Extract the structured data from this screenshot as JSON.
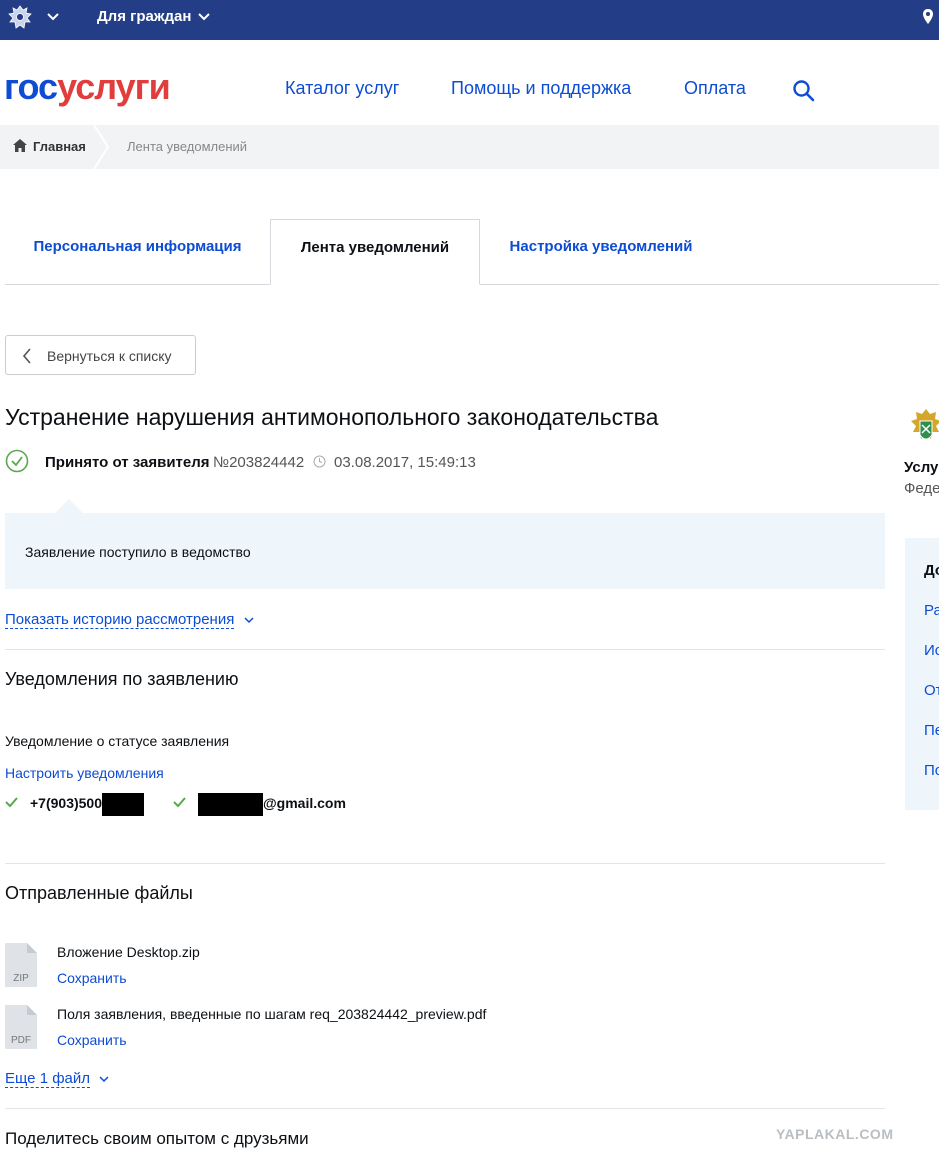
{
  "topbar": {
    "citizens_label": "Для граждан",
    "icons": [
      "emblem-icon",
      "chevron-down-icon",
      "location-pin-icon"
    ]
  },
  "header": {
    "logo_part1": "гос",
    "logo_part2": "услуги",
    "nav": [
      "Каталог услуг",
      "Помощь и поддержка",
      "Оплата"
    ],
    "search_icon": "search-icon"
  },
  "breadcrumb": {
    "home": "Главная",
    "current": "Лента уведомлений"
  },
  "tabs": [
    {
      "label": "Персональная информация",
      "active": false
    },
    {
      "label": "Лента уведомлений",
      "active": true
    },
    {
      "label": "Настройка уведомлений",
      "active": false
    }
  ],
  "back_button": "Вернуться к списку",
  "application": {
    "title": "Устранение нарушения антимонопольного законодательства",
    "status": "Принято от заявителя",
    "number": "№203824442",
    "datetime": "03.08.2017, 15:49:13",
    "message": "Заявление поступило в ведомство",
    "history_link": "Показать историю рассмотрения"
  },
  "notifications": {
    "heading": "Уведомления по заявлению",
    "type": "Уведомление о статусе заявления",
    "settings_link": "Настроить уведомления",
    "phone_prefix": "+7(903)500",
    "email_suffix": "@gmail.com"
  },
  "files": {
    "heading": "Отправленные файлы",
    "items": [
      {
        "ext": "ZIP",
        "name": "Вложение Desktop.zip",
        "action": "Сохранить"
      },
      {
        "ext": "PDF",
        "name": "Поля заявления, введенные по шагам req_203824442_preview.pdf",
        "action": "Сохранить"
      }
    ],
    "more_link": "Еще 1 файл"
  },
  "share": {
    "heading": "Поделитесь своим опытом с друзьями"
  },
  "sidebar": {
    "service_label": "Услу",
    "agency_label": "Феде",
    "box_heading": "До",
    "box_items": [
      "Ра",
      "Ис",
      "От",
      "Пе",
      "По"
    ]
  },
  "watermark": "YAPLAKAL.COM",
  "colors": {
    "topbar": "#233d87",
    "link": "#0d4cd3",
    "logo_red": "#e13d3c",
    "success": "#5aa84f",
    "info_bg": "#eef5fb"
  }
}
